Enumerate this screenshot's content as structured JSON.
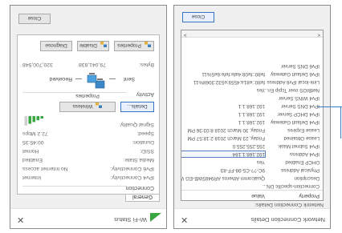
{
  "left_window": {
    "title": "Wi-Fi Status",
    "tab": "General",
    "connection_group": "Connection",
    "rows": [
      {
        "label": "IPv4 Connectivity:",
        "value": "Internet"
      },
      {
        "label": "IPv6 Connectivity:",
        "value": "No Internet access"
      },
      {
        "label": "Media State:",
        "value": "Enabled"
      },
      {
        "label": "SSID:",
        "value": "Hornet"
      },
      {
        "label": "Duration:",
        "value": "00:45:35"
      },
      {
        "label": "Speed:",
        "value": "72.2 Mbps"
      }
    ],
    "signal_label": "Signal Quality:",
    "details_button": "Details...",
    "wireless_button": "Wireless Properties",
    "activity_group": "Activity",
    "sent_label": "Sent",
    "received_label": "Received",
    "bytes_label": "Bytes:",
    "bytes_sent": "79,041,838",
    "bytes_received": "320,700,548",
    "properties_button": "Properties",
    "disable_button": "Disable",
    "diagnose_button": "Diagnose",
    "close_button": "Close"
  },
  "right_window": {
    "title": "Network Connection Details",
    "section_label": "Network Connection Details:",
    "col_property": "Property",
    "col_value": "Value",
    "rows": [
      {
        "p": "Connection-specific DN...",
        "v": ""
      },
      {
        "p": "Description",
        "v": "Qualcomm Atheros AR9485WB-EG Wirel"
      },
      {
        "p": "Physical Address",
        "v": "9C-??-C5-98-FF-83"
      },
      {
        "p": "DHCP Enabled",
        "v": "Yes"
      },
      {
        "p": "IPv4 Address",
        "v": "192.168.1.184"
      },
      {
        "p": "IPv4 Subnet Mask",
        "v": "255.255.255.0"
      },
      {
        "p": "Lease Obtained",
        "v": "Friday, 23 March 2018 2:18:57 PM"
      },
      {
        "p": "Lease Expires",
        "v": "Friday, 30 March 2018 8:03:36 PM"
      },
      {
        "p": "IPv4 Default Gateway",
        "v": "192.168.1.1"
      },
      {
        "p": "IPv4 DHCP Server",
        "v": "192.168.1.1"
      },
      {
        "p": "IPv4 DNS Server",
        "v": "192.168.1.1"
      },
      {
        "p": "IPv4 WINS Server",
        "v": ""
      },
      {
        "p": "NetBIOS over Tcpip En...",
        "v": "Yes"
      },
      {
        "p": "Link-local IPv6 Address",
        "v": "fe80::e81a:4559:e532:3068%11"
      },
      {
        "p": "IPv6 Default Gateway",
        "v": "fe80::fe08:4afe:fefe:6e5%11"
      },
      {
        "p": "IPv6 DNS Server",
        "v": ""
      }
    ],
    "selected_index": 4,
    "close_button": "Close"
  },
  "icons": {
    "wifi": "wifi-signal-icon",
    "close": "close-x-icon",
    "network": "network-computers-icon",
    "shield": "shield-icon",
    "scroll_left": "chevron-left-icon",
    "scroll_right": "chevron-right-icon"
  },
  "colors": {
    "accent": "#3d7ebf",
    "signal": "#3aa640",
    "selection_border": "#5c7fc2"
  },
  "signal_strength": 0.8
}
